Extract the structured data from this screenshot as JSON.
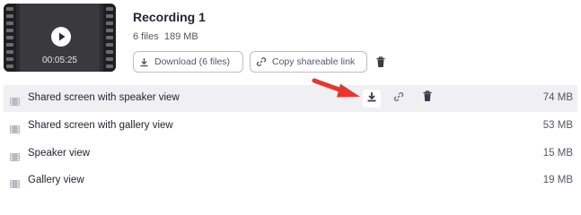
{
  "recording": {
    "title": "Recording 1",
    "meta": "6 files  189 MB",
    "duration": "00:05:25",
    "download_label": "Download (6 files)",
    "copy_link_label": "Copy shareable link"
  },
  "files": [
    {
      "name": "Shared screen with speaker view",
      "size": "74 MB",
      "highlighted": true
    },
    {
      "name": "Shared screen with gallery view",
      "size": "53 MB",
      "highlighted": false
    },
    {
      "name": "Speaker view",
      "size": "15 MB",
      "highlighted": false
    },
    {
      "name": "Gallery view",
      "size": "19 MB",
      "highlighted": false
    }
  ],
  "icons": {
    "thumbnail": "video-film-icon",
    "play": "play-icon",
    "download": "download-icon",
    "link": "link-icon",
    "trash": "trash-icon",
    "file": "video-file-icon",
    "annotation": "red-arrow-icon"
  },
  "colors": {
    "accent_arrow": "#e8362e",
    "row_highlight": "#f0f0f2",
    "text_primary": "#232333",
    "text_secondary": "#555566"
  }
}
